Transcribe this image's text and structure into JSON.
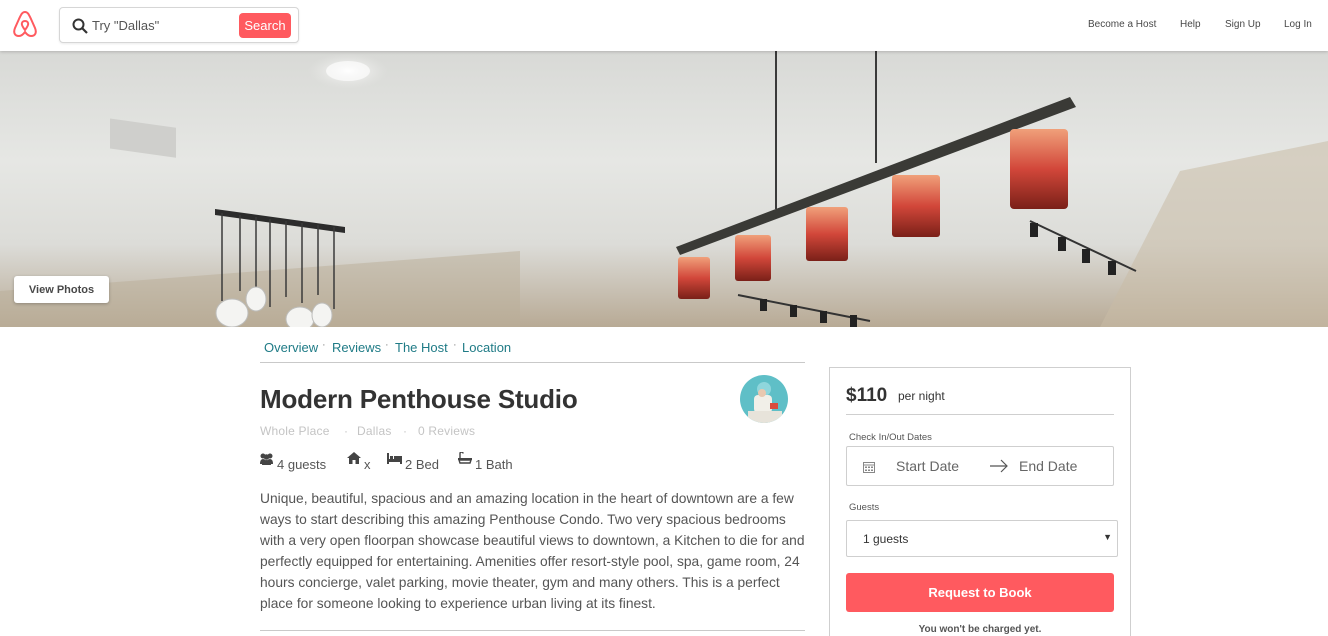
{
  "header": {
    "search_placeholder": "Try \"Dallas\"",
    "search_button": "Search",
    "nav": [
      "Become a Host",
      "Help",
      "Sign Up",
      "Log In"
    ]
  },
  "hero": {
    "view_photos": "View Photos"
  },
  "subnav": [
    "Overview",
    "Reviews",
    "The Host",
    "Location"
  ],
  "listing": {
    "title": "Modern Penthouse Studio",
    "meta": [
      "Whole Place",
      "Dallas",
      "0 Reviews"
    ],
    "features": {
      "guests": "4 guests",
      "home": "x",
      "beds": "2 Bed",
      "baths": "1 Bath"
    },
    "description": "Unique, beautiful, spacious and an amazing location in the heart of downtown are a few ways to start describing this amazing Penthouse Condo. Two very spacious bedrooms with a very open floorpan showcase beautiful views to downtown, a Kitchen to die for and perfectly equipped for entertaining. Amenities offer resort-style pool, spa, game room, 24 hours concierge, valet parking, movie theater, gym and many others. This is a perfect place for someone looking to experience urban living at its finest."
  },
  "booking": {
    "price": "$110",
    "per_night": "per night",
    "dates_label": "Check In/Out Dates",
    "start_date": "Start Date",
    "end_date": "End Date",
    "guests_label": "Guests",
    "guests_value": "1 guests",
    "book_button": "Request to Book",
    "note": "You won't be charged yet."
  },
  "colors": {
    "accent": "#ff5a5f",
    "link": "#1f7b86"
  }
}
